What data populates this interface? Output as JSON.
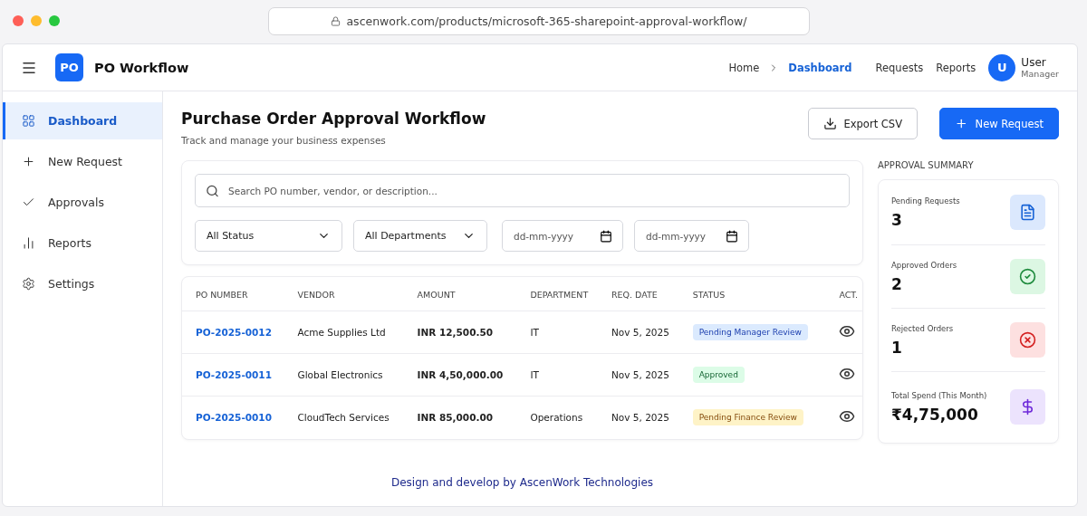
{
  "browser": {
    "url": "ascenwork.com/products/microsoft-365-sharepoint-approval-workflow/"
  },
  "header": {
    "logo": "PO",
    "title": "PO Workflow",
    "nav": [
      {
        "label": "Home",
        "selected": false
      },
      {
        "label": "Dashboard",
        "selected": true
      },
      {
        "label": "Requests",
        "selected": false
      },
      {
        "label": "Reports",
        "selected": false
      }
    ],
    "user": {
      "initial": "U",
      "name": "User",
      "role": "Manager"
    }
  },
  "sidebar": {
    "items": [
      {
        "label": "Dashboard",
        "kind": "grid",
        "selected": true
      },
      {
        "label": "New Request",
        "kind": "plus",
        "selected": false
      },
      {
        "label": "Approvals",
        "kind": "check",
        "selected": false
      },
      {
        "label": "Reports",
        "kind": "chart",
        "selected": false
      },
      {
        "label": "Settings",
        "kind": "gear",
        "selected": false
      }
    ]
  },
  "page": {
    "title": "Purchase Order Approval Workflow",
    "subtitle": "Track and manage your business expenses",
    "buttons": [
      {
        "label": "Export CSV",
        "kind": "export"
      },
      {
        "label": "New Request",
        "kind": "new"
      }
    ]
  },
  "filters": {
    "search_placeholder": "Search PO number, vendor, or description...",
    "selects": [
      "All Status",
      "All Departments"
    ],
    "dates": [
      {
        "placeholder": "dd-mm-yyyy"
      },
      {
        "placeholder": "dd-mm-yyyy"
      }
    ]
  },
  "table": {
    "columns": [
      "PO NUMBER",
      "VENDOR",
      "AMOUNT",
      "DEPARTMENT",
      "REQ. DATE",
      "STATUS",
      "ACT."
    ],
    "rows": [
      {
        "po": "PO-2025-0012",
        "vendor": "Acme Supplies Ltd",
        "amount": "INR 12,500.50",
        "department": "IT",
        "date": "Nov 5, 2025",
        "status": {
          "label": "Pending Manager Review",
          "kind": "info"
        }
      },
      {
        "po": "PO-2025-0011",
        "vendor": "Global Electronics",
        "amount": "INR 4,50,000.00",
        "department": "IT",
        "date": "Nov 5, 2025",
        "status": {
          "label": "Approved",
          "kind": "success"
        }
      },
      {
        "po": "PO-2025-0010",
        "vendor": "CloudTech Services",
        "amount": "INR 85,000.00",
        "department": "Operations",
        "date": "Nov 5, 2025",
        "status": {
          "label": "Pending Finance Review",
          "kind": "warning"
        }
      }
    ]
  },
  "summary": {
    "title": "APPROVAL SUMMARY",
    "items": [
      {
        "label": "Pending Requests",
        "value": "3",
        "kind": "document"
      },
      {
        "label": "Approved Orders",
        "value": "2",
        "kind": "check"
      },
      {
        "label": "Rejected Orders",
        "value": "1",
        "kind": "cross"
      },
      {
        "label": "Total Spend (This Month)",
        "value": "₹4,75,000",
        "kind": "dollar"
      }
    ]
  },
  "footer": "Design and develop by AscenWork Technologies"
}
